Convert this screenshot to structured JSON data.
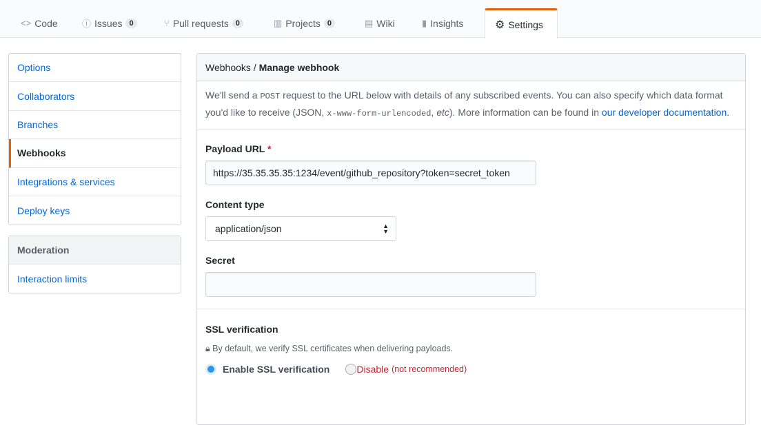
{
  "tabs": [
    {
      "label": "Code",
      "icon": "code-icon",
      "glyph": "<>"
    },
    {
      "label": "Issues",
      "icon": "issue-icon",
      "glyph": "ⓘ",
      "count": "0"
    },
    {
      "label": "Pull requests",
      "icon": "pull-request-icon",
      "glyph": "⑂",
      "count": "0"
    },
    {
      "label": "Projects",
      "icon": "project-icon",
      "glyph": "▥",
      "count": "0"
    },
    {
      "label": "Wiki",
      "icon": "book-icon",
      "glyph": "▤"
    },
    {
      "label": "Insights",
      "icon": "graph-icon",
      "glyph": "▮"
    },
    {
      "label": "Settings",
      "icon": "gear-icon",
      "glyph": "⚙"
    }
  ],
  "sidebar": {
    "items": [
      "Options",
      "Collaborators",
      "Branches",
      "Webhooks",
      "Integrations & services",
      "Deploy keys"
    ],
    "moderation_title": "Moderation",
    "moderation_items": [
      "Interaction limits"
    ]
  },
  "header": {
    "crumb": "Webhooks",
    "sep": " / ",
    "title": "Manage webhook"
  },
  "intro": {
    "t1": "We'll send a ",
    "post": "POST",
    "t2": " request to the URL below with details of any subscribed events. You can also specify which data format you'd like to receive (JSON, ",
    "form": "x-www-form-urlencoded",
    "t3": ", ",
    "etc": "etc",
    "t4": "). More information can be found in ",
    "link": "our developer documentation",
    "t5": "."
  },
  "form": {
    "payload_label": "Payload URL",
    "required": "*",
    "payload_value": "https://35.35.35.35:1234/event/github_repository?token=secret_token",
    "content_label": "Content type",
    "content_value": "application/json",
    "secret_label": "Secret",
    "secret_value": ""
  },
  "ssl": {
    "title": "SSL verification",
    "note": "By default, we verify SSL certificates when delivering payloads.",
    "enable": "Enable SSL verification",
    "disable": "Disable",
    "disable_note": "(not recommended)",
    "selected": "enable"
  }
}
